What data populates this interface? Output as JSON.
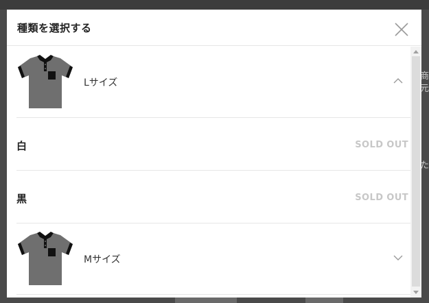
{
  "dialog": {
    "title": "種類を選択する",
    "close_icon": "close-icon"
  },
  "sizes": [
    {
      "label": "Lサイズ",
      "icon": "polo-shirt-icon",
      "expanded": true,
      "chevron": "chevron-up-icon",
      "colors": [
        {
          "label": "白",
          "status": "SOLD OUT"
        },
        {
          "label": "黒",
          "status": "SOLD OUT"
        }
      ]
    },
    {
      "label": "Mサイズ",
      "icon": "polo-shirt-icon",
      "expanded": false,
      "chevron": "chevron-down-icon"
    }
  ],
  "backdrop": {
    "right_text_1": "商",
    "right_text_2": "元",
    "right_text_3": "た"
  },
  "colors": {
    "divider": "#e6e6e6",
    "sold_out_text": "#c7c7c7",
    "shirt_body": "#6f6f6f",
    "shirt_trim": "#111111"
  }
}
